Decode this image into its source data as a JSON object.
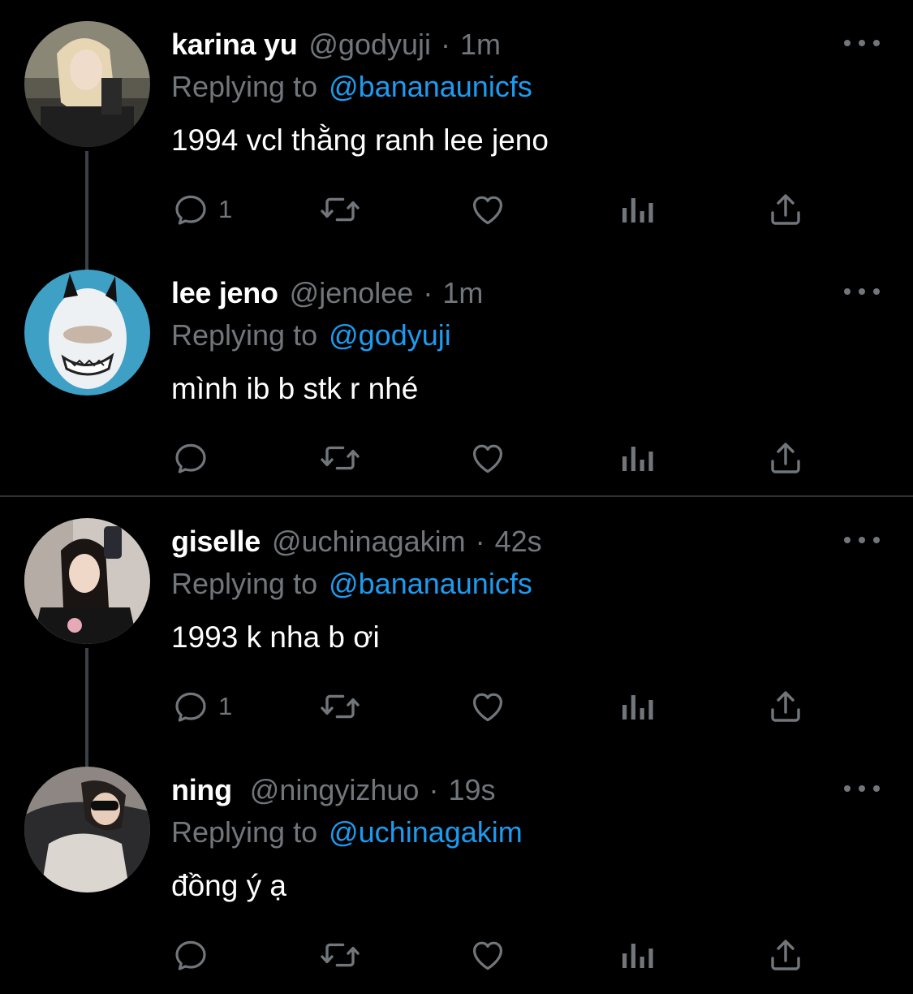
{
  "colors": {
    "background": "#000000",
    "name": "#ffffff",
    "secondary_text": "#71767b",
    "link": "#1d9bf0",
    "icon": "#71767b"
  },
  "tweets": [
    {
      "name": "karina yu",
      "handle": "@godyuji",
      "separator": "·",
      "time": "1m",
      "replying_prefix": "Replying to",
      "replying_to": "@bananaunicfs",
      "text": "1994 vcl thằng ranh lee jeno",
      "reply_count": "1"
    },
    {
      "name": "lee jeno",
      "handle": "@jenolee",
      "separator": "·",
      "time": "1m",
      "replying_prefix": "Replying to",
      "replying_to": "@godyuji",
      "text": "mình ib b stk r nhé",
      "reply_count": ""
    },
    {
      "name": "giselle",
      "handle": "@uchinagakim",
      "separator": "·",
      "time": "42s",
      "replying_prefix": "Replying to",
      "replying_to": "@bananaunicfs",
      "text": "1993 k nha b ơi",
      "reply_count": "1"
    },
    {
      "name": "ning",
      "handle": "@ningyizhuo",
      "separator": "·",
      "time": "19s",
      "replying_prefix": "Replying to",
      "replying_to": "@uchinagakim",
      "text": "đồng ý ạ",
      "reply_count": ""
    }
  ],
  "icons": {
    "avatar_icon": "avatar-photo",
    "more_icon": "more-horizontal-icon",
    "reply_icon": "reply-icon",
    "retweet_icon": "retweet-icon",
    "like_icon": "heart-icon",
    "views_icon": "analytics-icon",
    "share_icon": "share-icon"
  }
}
